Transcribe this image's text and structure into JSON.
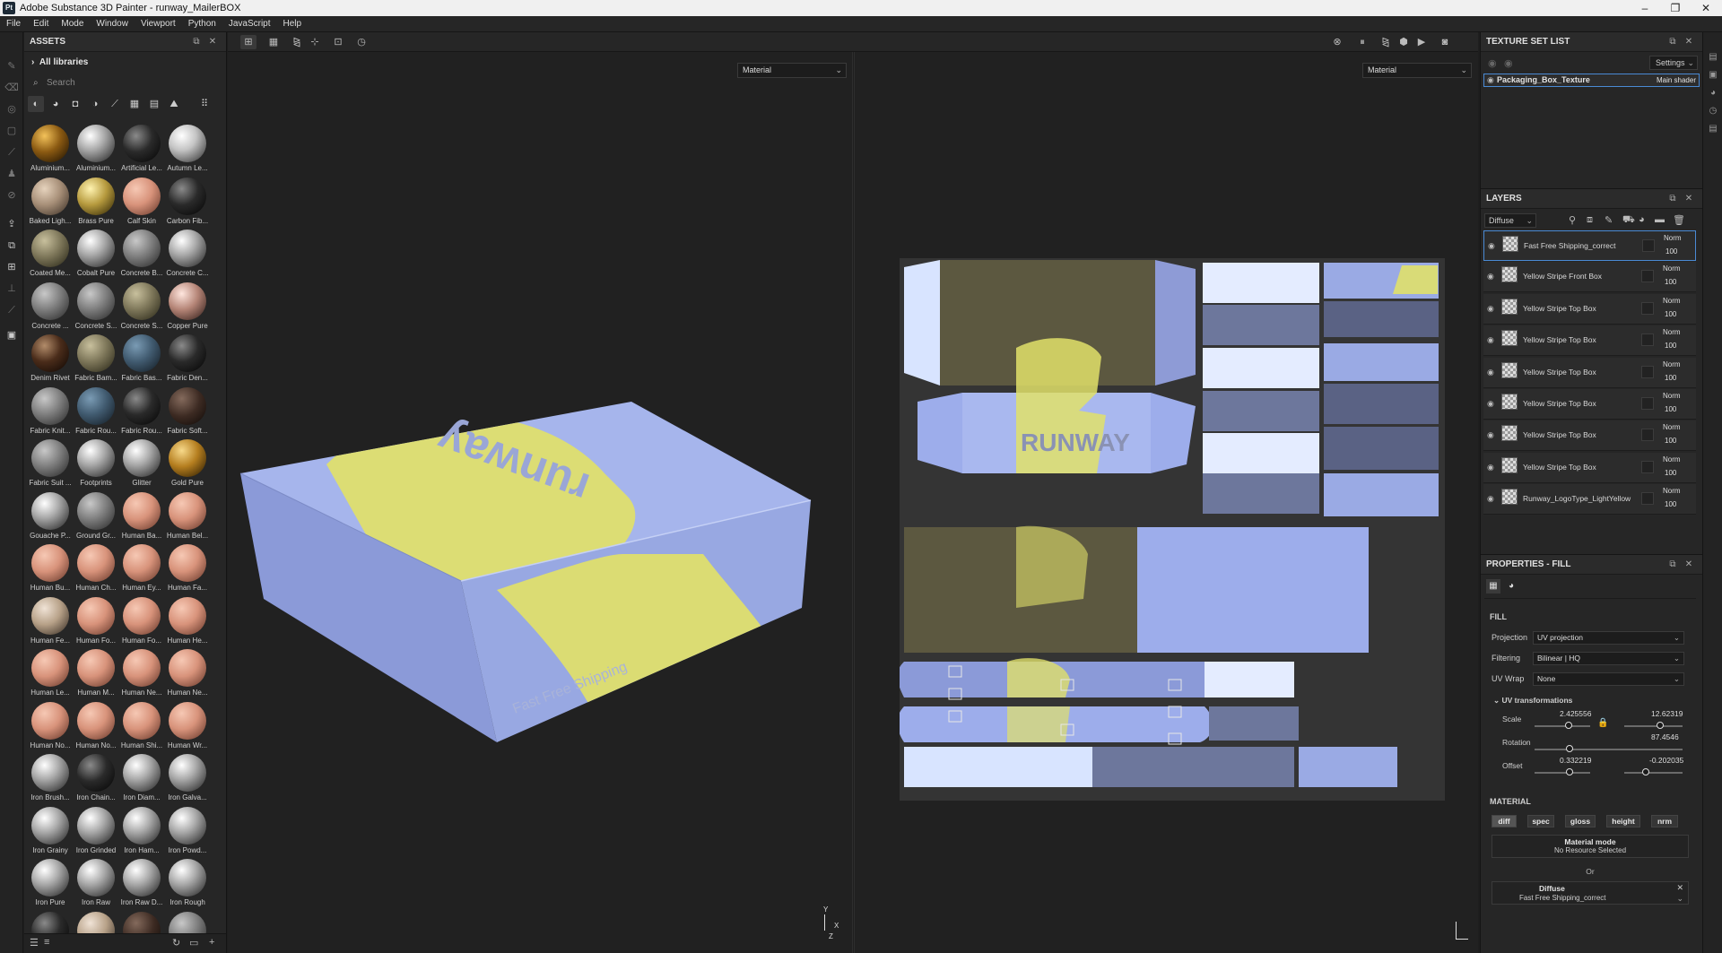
{
  "titlebar": {
    "app_icon": "Pt",
    "title": "Adobe Substance 3D Painter - runway_MailerBOX",
    "minimize": "–",
    "maximize": "❐",
    "close": "✕"
  },
  "menu": [
    "File",
    "Edit",
    "Mode",
    "Window",
    "Viewport",
    "Python",
    "JavaScript",
    "Help"
  ],
  "assets": {
    "title": "ASSETS",
    "library": "All libraries",
    "search_placeholder": "Search",
    "items": [
      {
        "label": "Aluminium...",
        "style": "goldtex"
      },
      {
        "label": "Aluminium...",
        "style": "silver"
      },
      {
        "label": "Artificial Le...",
        "style": "dark"
      },
      {
        "label": "Autumn Le...",
        "style": "leaf"
      },
      {
        "label": "Baked Ligh...",
        "style": "beige"
      },
      {
        "label": "Brass Pure",
        "style": "brass"
      },
      {
        "label": "Calf Skin",
        "style": "skin"
      },
      {
        "label": "Carbon Fib...",
        "style": "dark"
      },
      {
        "label": "Coated Me...",
        "style": "olive"
      },
      {
        "label": "Cobalt Pure",
        "style": "silver"
      },
      {
        "label": "Concrete B...",
        "style": "grey"
      },
      {
        "label": "Concrete C...",
        "style": "silver"
      },
      {
        "label": "Concrete ...",
        "style": "grey"
      },
      {
        "label": "Concrete S...",
        "style": "grey"
      },
      {
        "label": "Concrete S...",
        "style": "olive"
      },
      {
        "label": "Copper Pure",
        "style": "copper"
      },
      {
        "label": "Denim Rivet",
        "style": "denim"
      },
      {
        "label": "Fabric Bam...",
        "style": "olive"
      },
      {
        "label": "Fabric Bas...",
        "style": "teal"
      },
      {
        "label": "Fabric Den...",
        "style": "dark"
      },
      {
        "label": "Fabric Knit...",
        "style": "grey"
      },
      {
        "label": "Fabric Rou...",
        "style": "teal"
      },
      {
        "label": "Fabric Rou...",
        "style": "dark"
      },
      {
        "label": "Fabric Soft...",
        "style": "darkbrown"
      },
      {
        "label": "Fabric Suit ...",
        "style": "grey"
      },
      {
        "label": "Footprints",
        "style": "silver"
      },
      {
        "label": "Glitter",
        "style": "silver"
      },
      {
        "label": "Gold Pure",
        "style": "gold"
      },
      {
        "label": "Gouache P...",
        "style": "silver"
      },
      {
        "label": "Ground Gr...",
        "style": "grey"
      },
      {
        "label": "Human Ba...",
        "style": "skin"
      },
      {
        "label": "Human Bel...",
        "style": "skin"
      },
      {
        "label": "Human Bu...",
        "style": "skin"
      },
      {
        "label": "Human Ch...",
        "style": "skin"
      },
      {
        "label": "Human Ey...",
        "style": "skin"
      },
      {
        "label": "Human Fa...",
        "style": "skin"
      },
      {
        "label": "Human Fe...",
        "style": "mix"
      },
      {
        "label": "Human Fo...",
        "style": "skin"
      },
      {
        "label": "Human Fo...",
        "style": "skin"
      },
      {
        "label": "Human He...",
        "style": "skin"
      },
      {
        "label": "Human Le...",
        "style": "skin"
      },
      {
        "label": "Human M...",
        "style": "skin"
      },
      {
        "label": "Human Ne...",
        "style": "skin"
      },
      {
        "label": "Human Ne...",
        "style": "skin"
      },
      {
        "label": "Human No...",
        "style": "skin"
      },
      {
        "label": "Human No...",
        "style": "skin"
      },
      {
        "label": "Human Shi...",
        "style": "skin"
      },
      {
        "label": "Human Wr...",
        "style": "skin"
      },
      {
        "label": "Iron Brush...",
        "style": "silver"
      },
      {
        "label": "Iron Chain...",
        "style": "dark"
      },
      {
        "label": "Iron Diam...",
        "style": "silver"
      },
      {
        "label": "Iron Galva...",
        "style": "silver"
      },
      {
        "label": "Iron Grainy",
        "style": "silver"
      },
      {
        "label": "Iron Grinded",
        "style": "silver"
      },
      {
        "label": "Iron Ham...",
        "style": "silver"
      },
      {
        "label": "Iron Powd...",
        "style": "silver"
      },
      {
        "label": "Iron Pure",
        "style": "silver"
      },
      {
        "label": "Iron Raw",
        "style": "silver"
      },
      {
        "label": "Iron Raw D...",
        "style": "silver"
      },
      {
        "label": "Iron Rough",
        "style": "silver"
      },
      {
        "label": "",
        "style": "dark"
      },
      {
        "label": "",
        "style": "mix"
      },
      {
        "label": "",
        "style": "darkbrown"
      },
      {
        "label": "",
        "style": "grey"
      }
    ]
  },
  "viewport": {
    "left_dropdown": "Material",
    "right_dropdown": "Material",
    "box_logo": "runway",
    "box_tagline": "Fast Free Shipping",
    "uv_logo": "RUNWAY",
    "axis_y": "Y",
    "axis_x": "X",
    "axis_z": "Z"
  },
  "texture_set_list": {
    "title": "TEXTURE SET LIST",
    "settings": "Settings",
    "item": "Packaging_Box_Texture",
    "shader": "Main shader"
  },
  "layers": {
    "title": "LAYERS",
    "channel": "Diffuse",
    "items": [
      {
        "name": "Fast Free Shipping_correct",
        "blend": "Norm",
        "opacity": "100"
      },
      {
        "name": "Yellow Stripe Front  Box",
        "blend": "Norm",
        "opacity": "100"
      },
      {
        "name": "Yellow Stripe Top  Box",
        "blend": "Norm",
        "opacity": "100"
      },
      {
        "name": "Yellow Stripe Top  Box",
        "blend": "Norm",
        "opacity": "100"
      },
      {
        "name": "Yellow Stripe Top  Box",
        "blend": "Norm",
        "opacity": "100"
      },
      {
        "name": "Yellow Stripe Top  Box",
        "blend": "Norm",
        "opacity": "100"
      },
      {
        "name": "Yellow Stripe Top  Box",
        "blend": "Norm",
        "opacity": "100"
      },
      {
        "name": "Yellow Stripe Top Box",
        "blend": "Norm",
        "opacity": "100"
      },
      {
        "name": "Runway_LogoType_LightYellow",
        "blend": "Norm",
        "opacity": "100"
      }
    ]
  },
  "properties": {
    "title": "PROPERTIES - FILL",
    "fill_heading": "FILL",
    "projection_label": "Projection",
    "projection_value": "UV projection",
    "filtering_label": "Filtering",
    "filtering_value": "Bilinear | HQ",
    "uvwrap_label": "UV Wrap",
    "uvwrap_value": "None",
    "uvtrans_heading": "UV transformations",
    "scale_label": "Scale",
    "scale_x": "2.425556",
    "scale_y": "12.62319",
    "rotation_label": "Rotation",
    "rotation_value": "87.4546",
    "offset_label": "Offset",
    "offset_x": "0.332219",
    "offset_y": "-0.202035",
    "material_heading": "MATERIAL",
    "channels": [
      "diff",
      "spec",
      "gloss",
      "height",
      "nrm"
    ],
    "mode_title": "Material mode",
    "mode_sub": "No Resource Selected",
    "or": "Or",
    "diffuse_title": "Diffuse",
    "diffuse_value": "Fast Free Shipping_correct"
  },
  "colors": {
    "box_blue": "#9daee6",
    "stripe_yellow": "#e0e06a",
    "panel": "#262626",
    "accent": "#4a8ad4"
  }
}
